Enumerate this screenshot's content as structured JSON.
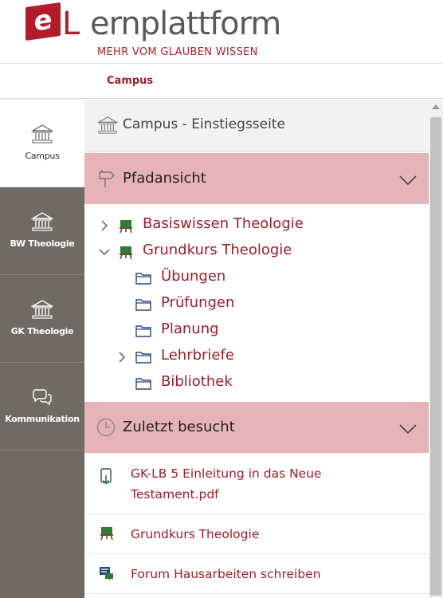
{
  "header": {
    "logo_e": "e",
    "logo_l": "L",
    "logo_rest": "ernplattform",
    "tagline": "MEHR VOM GLAUBEN WISSEN"
  },
  "breadcrumb": {
    "label": "Campus"
  },
  "sidebar": {
    "items": [
      {
        "label": "Campus",
        "icon": "building-icon",
        "active": true
      },
      {
        "label": "BW Theologie",
        "icon": "building-icon",
        "active": false
      },
      {
        "label": "GK Theologie",
        "icon": "building-icon",
        "active": false
      },
      {
        "label": "Kommunikation",
        "icon": "chat-bubbles-icon",
        "active": false
      }
    ]
  },
  "main": {
    "home": {
      "label": "Campus - Einstiegsseite",
      "icon": "building-icon"
    },
    "path_section": {
      "label": "Pfadansicht",
      "icon": "signpost-icon"
    },
    "tree": [
      {
        "label": "Basiswissen Theologie",
        "icon": "course-board-icon",
        "toggle": "collapsed"
      },
      {
        "label": "Grundkurs Theologie",
        "icon": "course-board-icon",
        "toggle": "expanded"
      },
      {
        "label": "Übungen",
        "icon": "folder-icon",
        "toggle": "none"
      },
      {
        "label": "Prüfungen",
        "icon": "folder-icon",
        "toggle": "none"
      },
      {
        "label": "Planung",
        "icon": "folder-icon",
        "toggle": "none"
      },
      {
        "label": "Lehrbriefe",
        "icon": "folder-icon",
        "toggle": "collapsed"
      },
      {
        "label": "Bibliothek",
        "icon": "folder-icon",
        "toggle": "none"
      }
    ],
    "recent_section": {
      "label": "Zuletzt besucht",
      "icon": "clock-icon"
    },
    "recent": [
      {
        "label": "GK-LB 5 Einleitung in das Neue Testament.pdf",
        "icon": "file-download-icon"
      },
      {
        "label": "Grundkurs Theologie",
        "icon": "course-board-icon"
      },
      {
        "label": "Forum Hausarbeiten schreiben",
        "icon": "forum-icon"
      }
    ]
  },
  "colors": {
    "brand_red": "#b31b2b",
    "link_red": "#9d1d2a",
    "section_pink": "#e6b3b8",
    "sidebar_gray": "#6f6a64"
  }
}
